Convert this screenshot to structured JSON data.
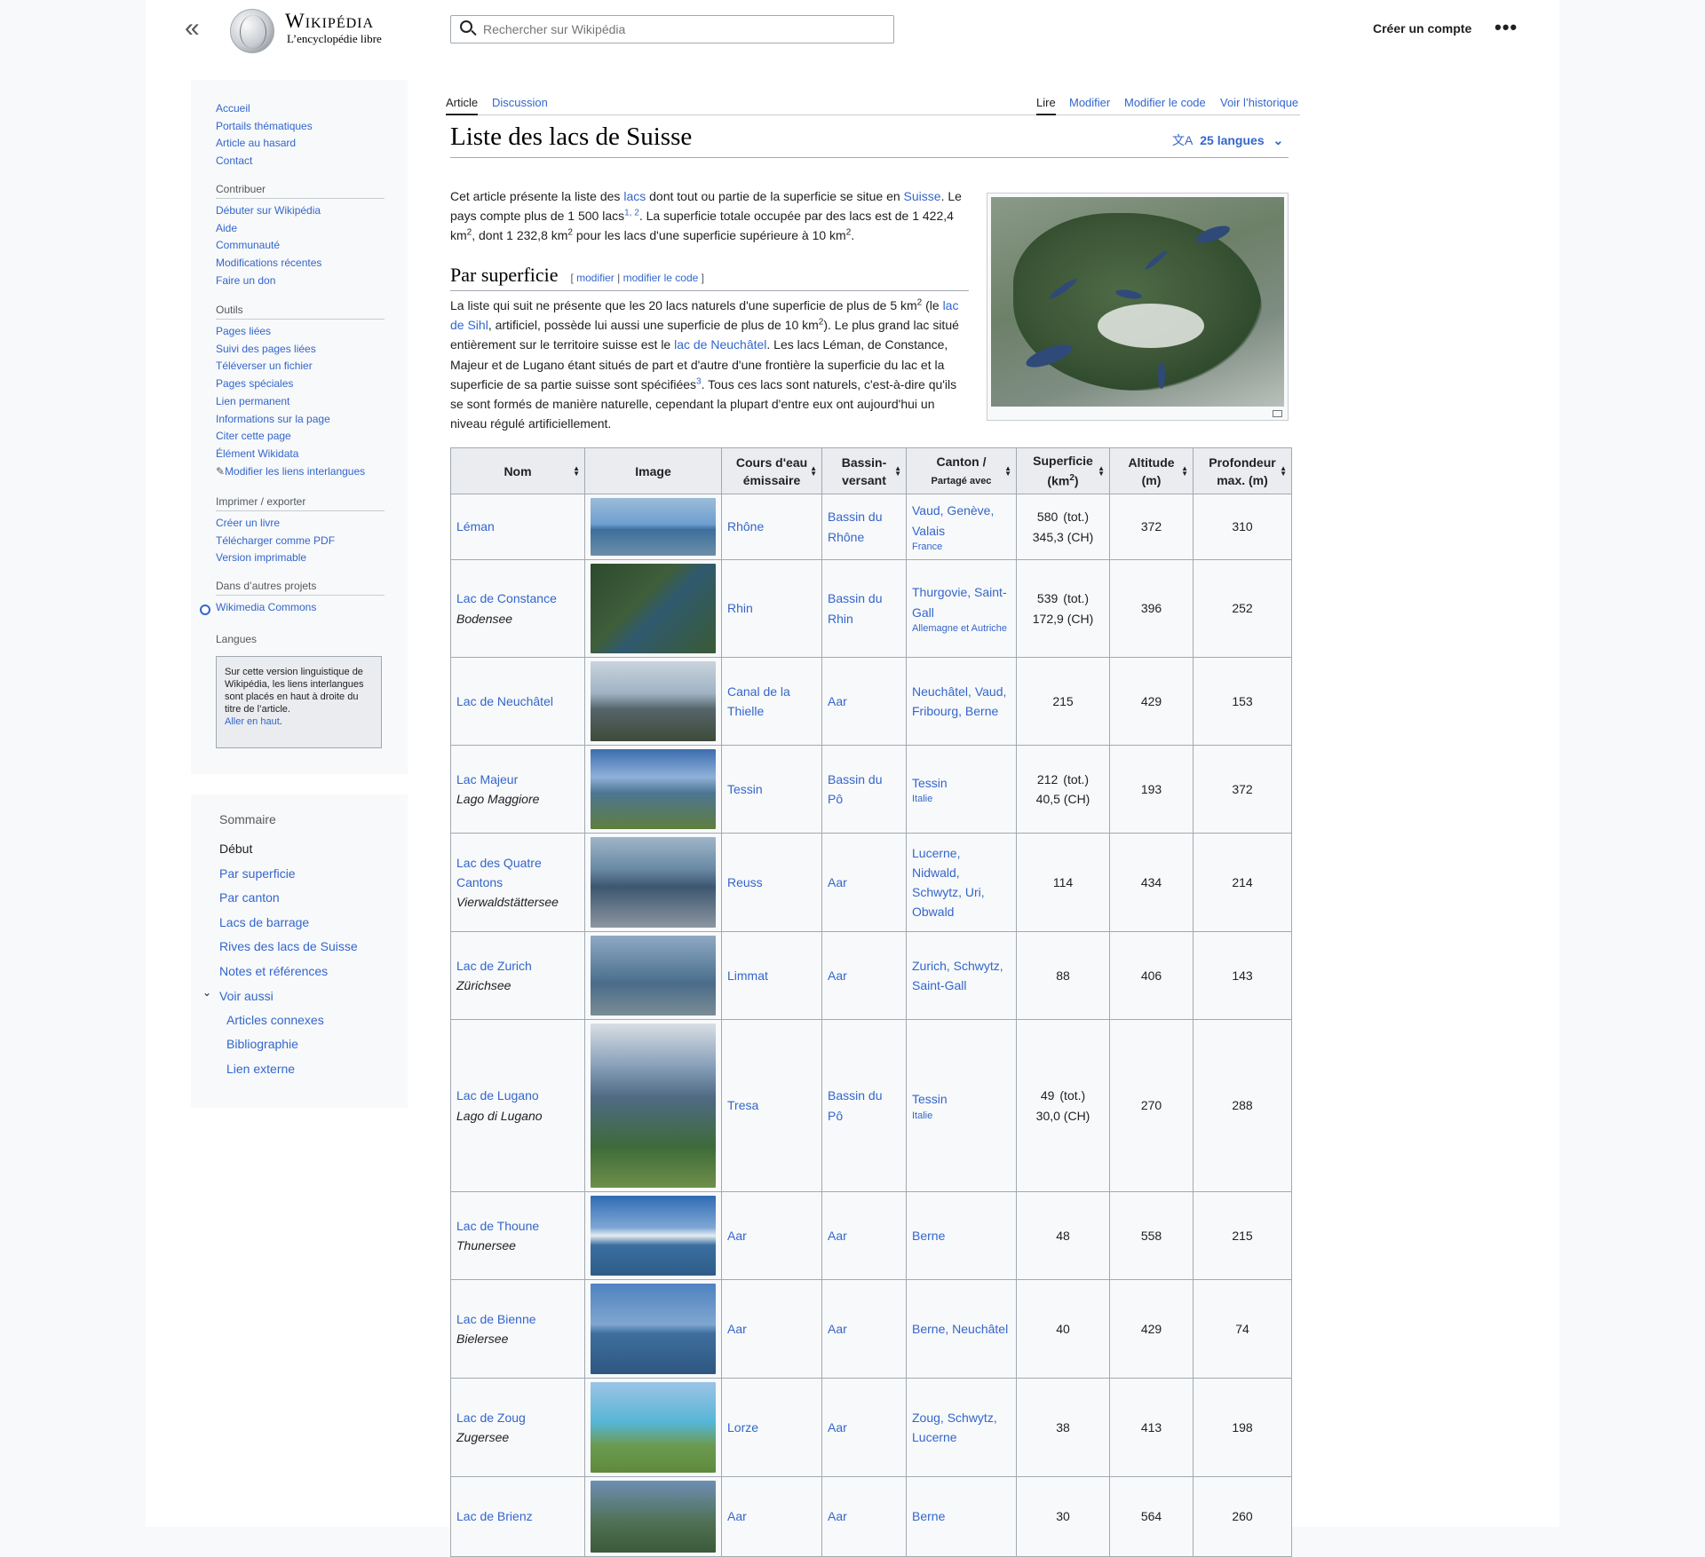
{
  "header": {
    "wordmark": "Wikipédia",
    "tagline": "L’encyclopédie libre",
    "search_placeholder": "Rechercher sur Wikipédia",
    "create_account": "Créer un compte",
    "more": "•••",
    "collapse_icon": "double-chevron-left"
  },
  "sidebar": {
    "nav": [
      "Accueil",
      "Portails thématiques",
      "Article au hasard",
      "Contact"
    ],
    "contribute_heading": "Contribuer",
    "contribute": [
      "Débuter sur Wikipédia",
      "Aide",
      "Communauté",
      "Modifications récentes",
      "Faire un don"
    ],
    "tools_heading": "Outils",
    "tools": [
      "Pages liées",
      "Suivi des pages liées",
      "Téléverser un fichier",
      "Pages spéciales",
      "Lien permanent",
      "Informations sur la page",
      "Citer cette page",
      "Élément Wikidata",
      "Modifier les liens interlangues"
    ],
    "print_heading": "Imprimer / exporter",
    "print": [
      "Créer un livre",
      "Télécharger comme PDF",
      "Version imprimable"
    ],
    "projects_heading": "Dans d’autres projets",
    "projects": [
      "Wikimedia Commons"
    ],
    "langs_heading": "Langues",
    "langs_notice": "Sur cette version linguistique de Wikipédia, les liens interlangues sont placés en haut à droite du titre de l’article.",
    "langs_link": "Aller en haut"
  },
  "toc": {
    "heading": "Sommaire",
    "items": [
      "Début",
      "Par superficie",
      "Par canton",
      "Lacs de barrage",
      "Rives des lacs de Suisse",
      "Notes et références",
      "Voir aussi",
      "Articles connexes",
      "Bibliographie",
      "Lien externe"
    ]
  },
  "tabs": {
    "article": "Article",
    "discussion": "Discussion",
    "read": "Lire",
    "edit": "Modifier",
    "edit_code": "Modifier le code",
    "history": "Voir l’historique"
  },
  "page": {
    "title": "Liste des lacs de Suisse",
    "languages": "25 langues"
  },
  "intro": {
    "t1": "Cet article présente la liste des ",
    "l1": "lacs",
    "t2": " dont tout ou partie de la superficie se situe en ",
    "l2": "Suisse",
    "t3": ". Le pays compte plus de 1 500 lacs",
    "s1": "1, 2",
    "t4": ". La superficie totale occupée par des lacs est de 1 422,4 km",
    "sq": "2",
    "t5": ", dont 1 232,8 km",
    "t6": " pour les lacs d'une superficie supérieure à 10 km",
    "t7": "."
  },
  "section": {
    "heading": "Par superficie",
    "edit_open": "[ ",
    "edit": "modifier",
    "sep": " | ",
    "edit_code": "modifier le code",
    "edit_close": " ]",
    "p1": "La liste qui suit ne présente que les 20 lacs naturels d'une superficie de plus de 5 km",
    "p2": " (le ",
    "l1": "lac de Sihl",
    "p3": ", artificiel, possède lui aussi une superficie de plus de 10 km",
    "p4": "). Le plus grand lac situé entièrement sur le territoire suisse est le ",
    "l2": "lac de Neuchâtel",
    "p5": ". Les lacs Léman, de Constance, Majeur et de Lugano étant situés de part et d'autre d'une frontière la superficie du lac et la superficie de sa partie suisse sont spécifiées",
    "s3": "3",
    "p6": ". Tous ces lacs sont naturels, c'est-à-dire qu'ils se sont formés de manière naturelle, cependant la plupart d'entre eux ont aujourd'hui un niveau régulé artificiellement."
  },
  "table": {
    "headers": {
      "name": "Nom",
      "image": "Image",
      "river_a": "Cours d'eau",
      "river_b": "émissaire",
      "basin_a": "Bassin-",
      "basin_b": "versant",
      "canton_a": "Canton /",
      "canton_b": "Partagé avec",
      "area_a": "Superficie",
      "area_b": "(km",
      "area_sup": "2",
      "area_c": ")",
      "alt_a": "Altitude",
      "alt_b": "(m)",
      "depth_a": "Profondeur",
      "depth_b": "max. (m)",
      "sort_icon": "▲▼"
    },
    "rows": [
      {
        "name": "Léman",
        "alt": "",
        "river": "Rhône",
        "basin": "Bassin du Rhône",
        "cantons": "Vaud, Genève, Valais",
        "shared": "France",
        "area_tot": "580",
        "tot_label": "(tot.)",
        "area_ch": "345,3 (CH)",
        "altitude": "372",
        "depth": "310"
      },
      {
        "name": "Lac de Constance",
        "alt": "Bodensee",
        "river": "Rhin",
        "basin": "Bassin du Rhin",
        "cantons": "Thurgovie, Saint-Gall",
        "shared": "Allemagne et Autriche",
        "area_tot": "539",
        "tot_label": "(tot.)",
        "area_ch": "172,9 (CH)",
        "altitude": "396",
        "depth": "252"
      },
      {
        "name": "Lac de Neuchâtel",
        "alt": "",
        "river": "Canal de la Thielle",
        "basin": "Aar",
        "cantons": "Neuchâtel, Vaud, Fribourg, Berne",
        "shared": "",
        "area_tot": "215",
        "tot_label": "",
        "area_ch": "",
        "altitude": "429",
        "depth": "153"
      },
      {
        "name": "Lac Majeur",
        "alt": "Lago Maggiore",
        "river": "Tessin",
        "basin": "Bassin du Pô",
        "cantons": "Tessin",
        "shared": "Italie",
        "area_tot": "212",
        "tot_label": "(tot.)",
        "area_ch": "40,5 (CH)",
        "altitude": "193",
        "depth": "372"
      },
      {
        "name": "Lac des Quatre Cantons",
        "alt": "Vierwaldstättersee",
        "river": "Reuss",
        "basin": "Aar",
        "cantons": "Lucerne, Nidwald, Schwytz, Uri, Obwald",
        "shared": "",
        "area_tot": "114",
        "tot_label": "",
        "area_ch": "",
        "altitude": "434",
        "depth": "214"
      },
      {
        "name": "Lac de Zurich",
        "alt": "Zürichsee",
        "river": "Limmat",
        "basin": "Aar",
        "cantons": "Zurich, Schwytz, Saint-Gall",
        "shared": "",
        "area_tot": "88",
        "tot_label": "",
        "area_ch": "",
        "altitude": "406",
        "depth": "143"
      },
      {
        "name": "Lac de Lugano",
        "alt": "Lago di Lugano",
        "river": "Tresa",
        "basin": "Bassin du Pô",
        "cantons": "Tessin",
        "shared": "Italie",
        "area_tot": "49",
        "tot_label": "(tot.)",
        "area_ch": "30,0 (CH)",
        "altitude": "270",
        "depth": "288"
      },
      {
        "name": "Lac de Thoune",
        "alt": "Thunersee",
        "river": "Aar",
        "basin": "Aar",
        "cantons": "Berne",
        "shared": "",
        "area_tot": "48",
        "tot_label": "",
        "area_ch": "",
        "altitude": "558",
        "depth": "215"
      },
      {
        "name": "Lac de Bienne",
        "alt": "Bielersee",
        "river": "Aar",
        "basin": "Aar",
        "cantons": "Berne, Neuchâtel",
        "shared": "",
        "area_tot": "40",
        "tot_label": "",
        "area_ch": "",
        "altitude": "429",
        "depth": "74"
      },
      {
        "name": "Lac de Zoug",
        "alt": "Zugersee",
        "river": "Lorze",
        "basin": "Aar",
        "cantons": "Zoug, Schwytz, Lucerne",
        "shared": "",
        "area_tot": "38",
        "tot_label": "",
        "area_ch": "",
        "altitude": "413",
        "depth": "198"
      },
      {
        "name": "Lac de Brienz",
        "alt": "",
        "river": "Aar",
        "basin": "Aar",
        "cantons": "Berne",
        "shared": "",
        "area_tot": "30",
        "tot_label": "",
        "area_ch": "",
        "altitude": "564",
        "depth": "260"
      }
    ]
  },
  "colors": {
    "link": "#3366cc",
    "text": "#202122",
    "border": "#a2a9b1",
    "header_bg": "#eaecf0"
  }
}
